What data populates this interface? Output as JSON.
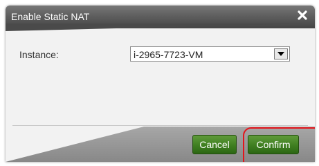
{
  "dialog": {
    "title": "Enable Static NAT",
    "close_icon": "close-x-icon"
  },
  "form": {
    "instance_label": "Instance:",
    "instance_value": "i-2965-7723-VM",
    "dropdown_icon": "chevron-down-icon"
  },
  "buttons": {
    "cancel_label": "Cancel",
    "confirm_label": "Confirm"
  },
  "colors": {
    "titlebar": "#5f5f5f",
    "button_green": "#3f7f20",
    "highlight_red": "#e4141b"
  }
}
